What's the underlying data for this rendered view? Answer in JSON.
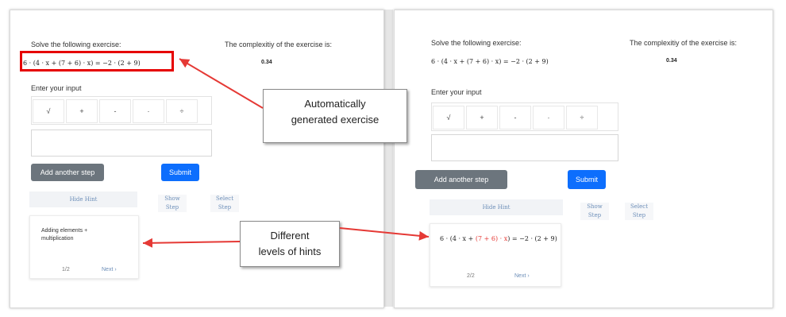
{
  "left": {
    "prompt": "Solve the following exercise:",
    "complexity_label": "The complexitiy of the exercise is:",
    "complexity_value": "0.34",
    "expr": {
      "a": "6 · (4 · x + (7 + 6) · x) = −2 · (2 + 9)"
    },
    "input_label": "Enter your input",
    "toolbar": [
      "√",
      "+",
      "-",
      "·",
      "÷"
    ],
    "add_step": "Add another step",
    "submit": "Submit",
    "hide_hint": "Hide Hint",
    "show_step": [
      "Show",
      "Step"
    ],
    "select_step": [
      "Select",
      "Step"
    ],
    "hint_line1": "Adding elements +",
    "hint_line2": "multiplication",
    "pager": "1/2",
    "next": "Next ›"
  },
  "right": {
    "prompt": "Solve the following exercise:",
    "complexity_label": "The complexitiy of the exercise is:",
    "complexity_value": "0.34",
    "expr": "6 · (4 · x + (7 + 6) · x) = −2 · (2 + 9)",
    "input_label": "Enter your input",
    "toolbar": [
      "√",
      "+",
      "-",
      "·",
      "÷"
    ],
    "add_step": "Add another step",
    "submit": "Submit",
    "hide_hint": "Hide Hint",
    "show_step": [
      "Show",
      "Step"
    ],
    "select_step": [
      "Select",
      "Step"
    ],
    "hint_expr": {
      "a": "6 · (4 · x + ",
      "b": "(7 + 6) · x",
      "c": ") = −2 · (2 + 9)"
    },
    "pager": "2/2",
    "next": "Next ›"
  },
  "callouts": {
    "auto_line1": "Automatically",
    "auto_line2": "generated exercise",
    "hints_line1": "Different",
    "hints_line2": "levels of hints"
  },
  "colors": {
    "highlight": "#e60000",
    "arrow": "#e53935",
    "primary": "#0d6efd",
    "secondary": "#6c757d"
  }
}
